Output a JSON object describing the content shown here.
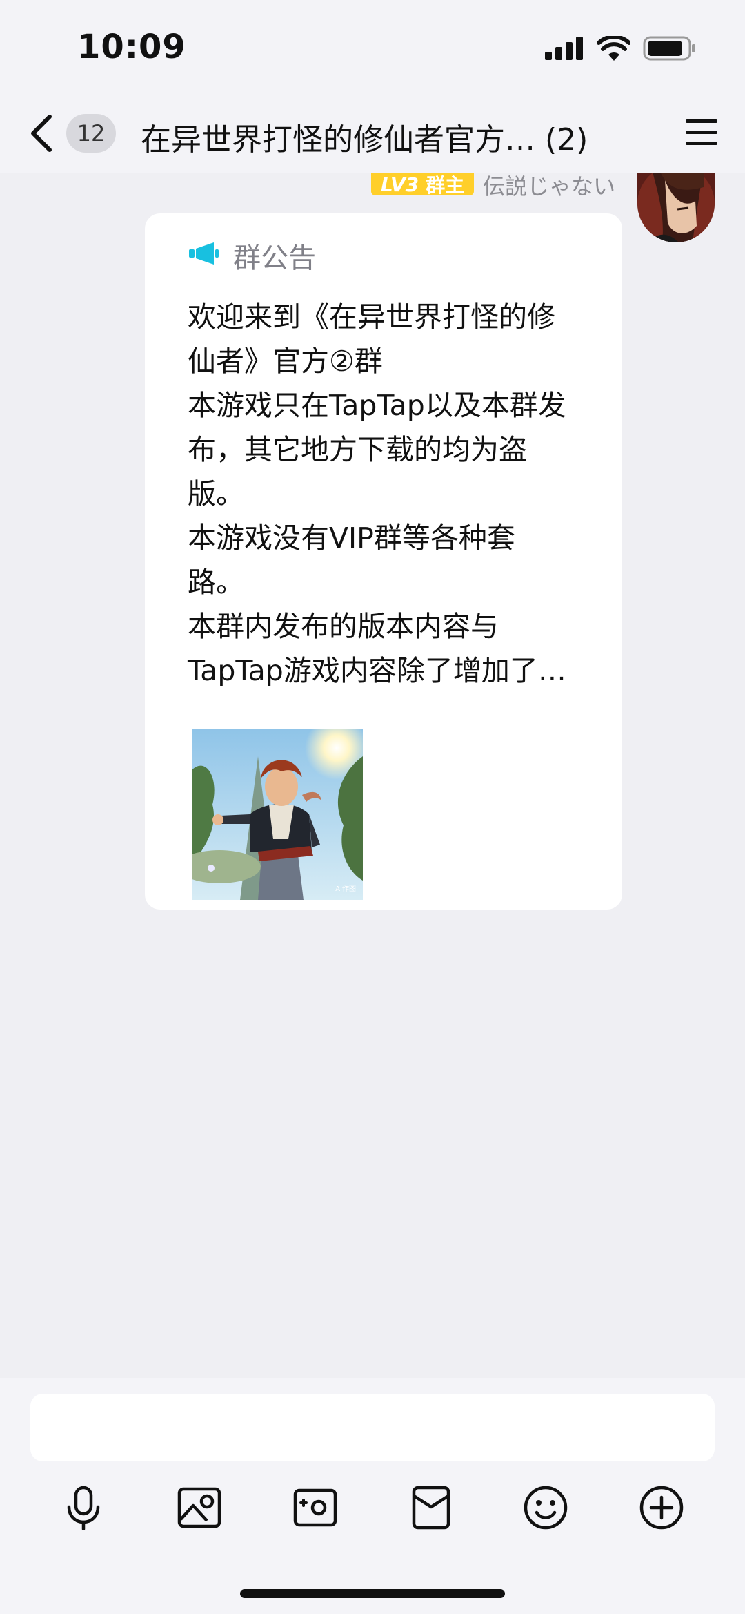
{
  "status_bar": {
    "time": "10:09",
    "icons": [
      "cellular-signal-icon",
      "wifi-icon",
      "battery-icon"
    ]
  },
  "nav": {
    "back_icon": "chevron-left-icon",
    "unread_count": "12",
    "title": "在异世界打怪的修仙者官方… (2)",
    "menu_icon": "hamburger-menu-icon"
  },
  "message": {
    "level_tag": "LV3",
    "role": "群主",
    "sender_name": "伝説じゃない",
    "avatar": "anime-avatar",
    "announcement": {
      "icon": "megaphone-icon",
      "title": "群公告",
      "body": "欢迎来到《在异世界打怪的修\n仙者》官方②群\n本游戏只在TapTap以及本群发\n布，其它地方下载的均为盗\n版。\n本游戏没有VIP群等各种套\n路。\n本群内发布的版本内容与\nTapTap游戏内容除了增加了…",
      "image_label": "AI作图"
    }
  },
  "composer": {
    "input_value": "",
    "toolbar": [
      "microphone-icon",
      "photo-icon",
      "camera-icon",
      "red-packet-icon",
      "emoji-icon",
      "plus-icon"
    ]
  },
  "colors": {
    "accent_cyan": "#18c0e0",
    "level_badge": "#ffcf2a",
    "background": "#efeff3"
  }
}
